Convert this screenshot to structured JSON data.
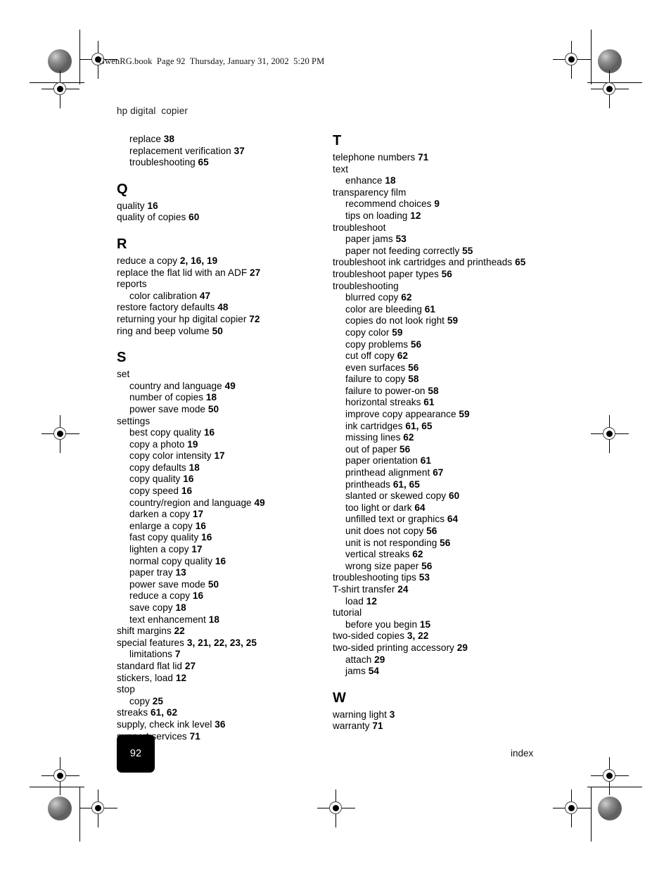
{
  "book_header": "GwenRG.book  Page 92  Thursday, January 31, 2002  5:20 PM",
  "running_head": "hp digital  copier",
  "footer": {
    "page_number": "92",
    "section_label": "index"
  },
  "columns": {
    "left": [
      {
        "type": "entry",
        "level": 2,
        "text": "replace",
        "pages": "38"
      },
      {
        "type": "entry",
        "level": 2,
        "text": "replacement verification",
        "pages": "37"
      },
      {
        "type": "entry",
        "level": 2,
        "text": "troubleshooting",
        "pages": "65"
      },
      {
        "type": "gap"
      },
      {
        "type": "letter",
        "text": "Q"
      },
      {
        "type": "entry",
        "level": 1,
        "text": "quality",
        "pages": "16"
      },
      {
        "type": "entry",
        "level": 1,
        "text": "quality of copies",
        "pages": "60"
      },
      {
        "type": "gap"
      },
      {
        "type": "letter",
        "text": "R"
      },
      {
        "type": "entry",
        "level": 1,
        "text": "reduce a copy",
        "pages": "2, 16, 19"
      },
      {
        "type": "entry",
        "level": 1,
        "text": "replace the flat lid with an ADF",
        "pages": "27"
      },
      {
        "type": "entry",
        "level": 1,
        "text": "reports",
        "pages": ""
      },
      {
        "type": "entry",
        "level": 2,
        "text": "color calibration",
        "pages": "47"
      },
      {
        "type": "entry",
        "level": 1,
        "text": "restore factory defaults",
        "pages": "48"
      },
      {
        "type": "entry",
        "level": 1,
        "text": "returning your hp digital copier",
        "pages": "72"
      },
      {
        "type": "entry",
        "level": 1,
        "text": "ring and beep volume",
        "pages": "50"
      },
      {
        "type": "gap"
      },
      {
        "type": "letter",
        "text": "S"
      },
      {
        "type": "entry",
        "level": 1,
        "text": "set",
        "pages": ""
      },
      {
        "type": "entry",
        "level": 2,
        "text": "country and language",
        "pages": "49"
      },
      {
        "type": "entry",
        "level": 2,
        "text": "number of copies",
        "pages": "18"
      },
      {
        "type": "entry",
        "level": 2,
        "text": "power save mode",
        "pages": "50"
      },
      {
        "type": "entry",
        "level": 1,
        "text": "settings",
        "pages": ""
      },
      {
        "type": "entry",
        "level": 2,
        "text": "best copy quality",
        "pages": "16"
      },
      {
        "type": "entry",
        "level": 2,
        "text": "copy a photo",
        "pages": "19"
      },
      {
        "type": "entry",
        "level": 2,
        "text": "copy color intensity",
        "pages": "17"
      },
      {
        "type": "entry",
        "level": 2,
        "text": "copy defaults",
        "pages": "18"
      },
      {
        "type": "entry",
        "level": 2,
        "text": "copy quality",
        "pages": "16"
      },
      {
        "type": "entry",
        "level": 2,
        "text": "copy speed",
        "pages": "16"
      },
      {
        "type": "entry",
        "level": 2,
        "text": "country/region and language",
        "pages": "49"
      },
      {
        "type": "entry",
        "level": 2,
        "text": "darken a copy",
        "pages": "17"
      },
      {
        "type": "entry",
        "level": 2,
        "text": "enlarge a copy",
        "pages": "16"
      },
      {
        "type": "entry",
        "level": 2,
        "text": "fast copy quality",
        "pages": "16"
      },
      {
        "type": "entry",
        "level": 2,
        "text": "lighten a copy",
        "pages": "17"
      },
      {
        "type": "entry",
        "level": 2,
        "text": "normal copy quality",
        "pages": "16"
      },
      {
        "type": "entry",
        "level": 2,
        "text": "paper tray",
        "pages": "13"
      },
      {
        "type": "entry",
        "level": 2,
        "text": "power save mode",
        "pages": "50"
      },
      {
        "type": "entry",
        "level": 2,
        "text": "reduce a copy",
        "pages": "16"
      },
      {
        "type": "entry",
        "level": 2,
        "text": "save copy",
        "pages": "18"
      },
      {
        "type": "entry",
        "level": 2,
        "text": "text enhancement",
        "pages": "18"
      },
      {
        "type": "entry",
        "level": 1,
        "text": "shift margins",
        "pages": "22"
      },
      {
        "type": "entry",
        "level": 1,
        "text": "special features",
        "pages": "3, 21, 22, 23, 25"
      },
      {
        "type": "entry",
        "level": 2,
        "text": "limitations",
        "pages": "7"
      },
      {
        "type": "entry",
        "level": 1,
        "text": "standard flat lid",
        "pages": "27"
      },
      {
        "type": "entry",
        "level": 1,
        "text": "stickers, load",
        "pages": "12"
      },
      {
        "type": "entry",
        "level": 1,
        "text": "stop",
        "pages": ""
      },
      {
        "type": "entry",
        "level": 2,
        "text": "copy",
        "pages": "25"
      },
      {
        "type": "entry",
        "level": 1,
        "text": "streaks",
        "pages": "61, 62"
      },
      {
        "type": "entry",
        "level": 1,
        "text": "supply, check ink level",
        "pages": "36"
      },
      {
        "type": "entry",
        "level": 1,
        "text": "support services",
        "pages": "71"
      }
    ],
    "right": [
      {
        "type": "letter",
        "text": "T"
      },
      {
        "type": "entry",
        "level": 1,
        "text": "telephone numbers",
        "pages": "71"
      },
      {
        "type": "entry",
        "level": 1,
        "text": "text",
        "pages": ""
      },
      {
        "type": "entry",
        "level": 2,
        "text": "enhance",
        "pages": "18"
      },
      {
        "type": "entry",
        "level": 1,
        "text": "transparency film",
        "pages": ""
      },
      {
        "type": "entry",
        "level": 2,
        "text": "recommend choices",
        "pages": "9"
      },
      {
        "type": "entry",
        "level": 2,
        "text": "tips on loading",
        "pages": "12"
      },
      {
        "type": "entry",
        "level": 1,
        "text": "troubleshoot",
        "pages": ""
      },
      {
        "type": "entry",
        "level": 2,
        "text": "paper jams",
        "pages": "53"
      },
      {
        "type": "entry",
        "level": 2,
        "text": "paper not feeding correctly",
        "pages": "55"
      },
      {
        "type": "entry",
        "level": 1,
        "text": "troubleshoot  ink cartridges and printheads",
        "pages": "65"
      },
      {
        "type": "entry",
        "level": 1,
        "text": "troubleshoot  paper types",
        "pages": "56"
      },
      {
        "type": "entry",
        "level": 1,
        "text": "troubleshooting",
        "pages": ""
      },
      {
        "type": "entry",
        "level": 2,
        "text": "blurred copy",
        "pages": "62"
      },
      {
        "type": "entry",
        "level": 2,
        "text": "color are bleeding",
        "pages": "61"
      },
      {
        "type": "entry",
        "level": 2,
        "text": "copies do not look right",
        "pages": "59"
      },
      {
        "type": "entry",
        "level": 2,
        "text": "copy color",
        "pages": "59"
      },
      {
        "type": "entry",
        "level": 2,
        "text": "copy problems",
        "pages": "56"
      },
      {
        "type": "entry",
        "level": 2,
        "text": "cut off copy",
        "pages": "62"
      },
      {
        "type": "entry",
        "level": 2,
        "text": "even surfaces",
        "pages": "56"
      },
      {
        "type": "entry",
        "level": 2,
        "text": "failure to copy",
        "pages": "58"
      },
      {
        "type": "entry",
        "level": 2,
        "text": "failure to power-on",
        "pages": "58"
      },
      {
        "type": "entry",
        "level": 2,
        "text": "horizontal streaks",
        "pages": "61"
      },
      {
        "type": "entry",
        "level": 2,
        "text": "improve copy appearance",
        "pages": "59"
      },
      {
        "type": "entry",
        "level": 2,
        "text": "ink cartridges",
        "pages": "61, 65"
      },
      {
        "type": "entry",
        "level": 2,
        "text": "missing lines",
        "pages": "62"
      },
      {
        "type": "entry",
        "level": 2,
        "text": "out of paper",
        "pages": "56"
      },
      {
        "type": "entry",
        "level": 2,
        "text": "paper orientation",
        "pages": "61"
      },
      {
        "type": "entry",
        "level": 2,
        "text": "printhead alignment",
        "pages": "67"
      },
      {
        "type": "entry",
        "level": 2,
        "text": "printheads",
        "pages": "61, 65"
      },
      {
        "type": "entry",
        "level": 2,
        "text": "slanted or skewed copy",
        "pages": "60"
      },
      {
        "type": "entry",
        "level": 2,
        "text": "too light or dark",
        "pages": "64"
      },
      {
        "type": "entry",
        "level": 2,
        "text": "unfilled text or graphics",
        "pages": "64"
      },
      {
        "type": "entry",
        "level": 2,
        "text": "unit does not copy",
        "pages": "56"
      },
      {
        "type": "entry",
        "level": 2,
        "text": "unit is not responding",
        "pages": "56"
      },
      {
        "type": "entry",
        "level": 2,
        "text": "vertical streaks",
        "pages": "62"
      },
      {
        "type": "entry",
        "level": 2,
        "text": "wrong size paper",
        "pages": "56"
      },
      {
        "type": "entry",
        "level": 1,
        "text": "troubleshooting tips",
        "pages": "53"
      },
      {
        "type": "entry",
        "level": 1,
        "text": "T-shirt transfer",
        "pages": "24"
      },
      {
        "type": "entry",
        "level": 2,
        "text": "load",
        "pages": "12"
      },
      {
        "type": "entry",
        "level": 1,
        "text": "tutorial",
        "pages": ""
      },
      {
        "type": "entry",
        "level": 2,
        "text": "before you begin",
        "pages": "15"
      },
      {
        "type": "entry",
        "level": 1,
        "text": "two-sided copies",
        "pages": "3, 22"
      },
      {
        "type": "entry",
        "level": 1,
        "text": "two-sided printing accessory",
        "pages": "29"
      },
      {
        "type": "entry",
        "level": 2,
        "text": "attach",
        "pages": "29"
      },
      {
        "type": "entry",
        "level": 2,
        "text": "jams",
        "pages": "54"
      },
      {
        "type": "gap"
      },
      {
        "type": "letter",
        "text": "W"
      },
      {
        "type": "entry",
        "level": 1,
        "text": "warning light",
        "pages": "3"
      },
      {
        "type": "entry",
        "level": 1,
        "text": "warranty",
        "pages": "71"
      }
    ]
  }
}
